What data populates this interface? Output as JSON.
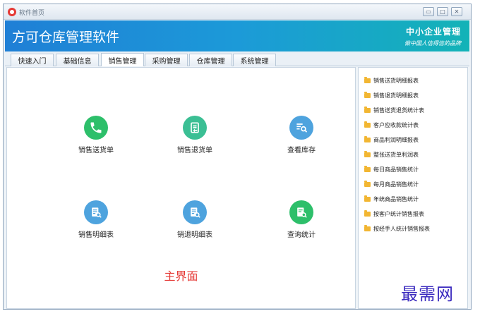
{
  "window": {
    "title": "软件首页"
  },
  "banner": {
    "app_name": "方可仓库管理软件",
    "slogan_line1": "中小企业管理",
    "slogan_line2": "做中国人信得信的品牌"
  },
  "tabs": [
    {
      "label": "快速入门",
      "active": false
    },
    {
      "label": "基础信息",
      "active": false
    },
    {
      "label": "销售管理",
      "active": true
    },
    {
      "label": "采购管理",
      "active": false
    },
    {
      "label": "仓库管理",
      "active": false
    },
    {
      "label": "系统管理",
      "active": false
    }
  ],
  "tiles": [
    {
      "label": "销售送货单",
      "icon": "phone-icon",
      "color": "#2dbf6a"
    },
    {
      "label": "销售退货单",
      "icon": "return-document-icon",
      "color": "#3bbf94"
    },
    {
      "label": "查看库存",
      "icon": "search-list-icon",
      "color": "#4ea3de"
    },
    {
      "label": "销售明细表",
      "icon": "report-search-icon",
      "color": "#4ea3de"
    },
    {
      "label": "销退明细表",
      "icon": "report-search-icon",
      "color": "#4ea3de"
    },
    {
      "label": "查询统计",
      "icon": "statistics-search-icon",
      "color": "#2dbf6a"
    }
  ],
  "main_caption": "主界面",
  "reports": [
    "销售送货明细报表",
    "销售退货明细报表",
    "销售送货退货统计表",
    "客户应收款统计表",
    "商品利润明细报表",
    "整张送货单利润表",
    "每日商品销售统计",
    "每月商品销售统计",
    "年统商品销售统计",
    "按客户统计销售报表",
    "按经手人统计销售报表"
  ],
  "watermark": "最需网",
  "colors": {
    "accent": "#1f7fd6",
    "caption": "#e53935",
    "folder": "#f2b632"
  }
}
